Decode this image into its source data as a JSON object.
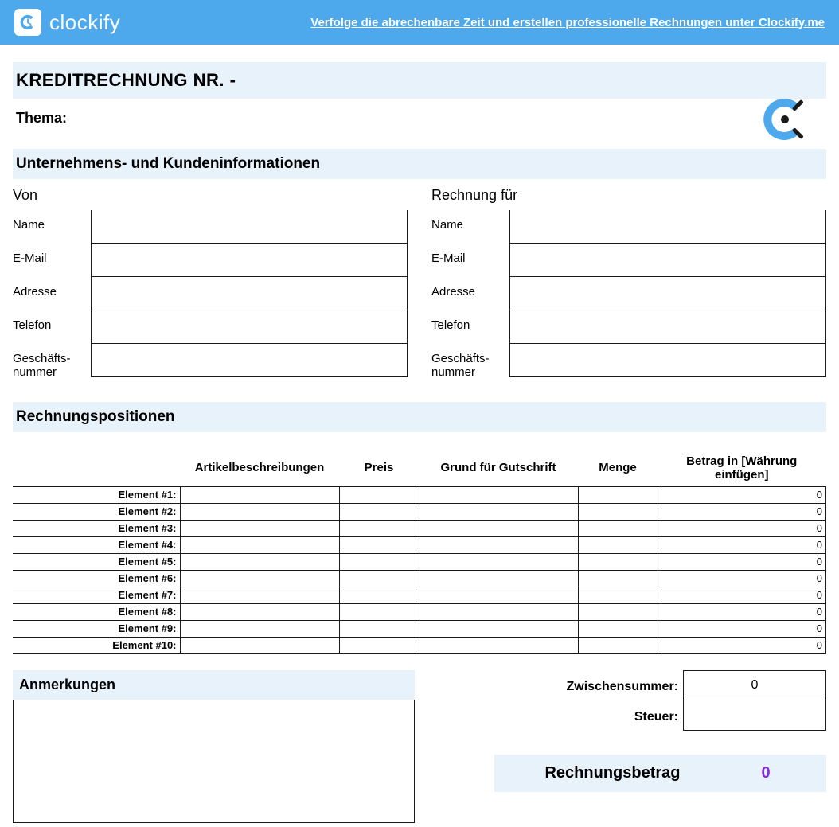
{
  "banner": {
    "brand": "clockify",
    "link_text": "Verfolge die abrechenbare Zeit und erstellen professionelle Rechnungen unter Clockify.me"
  },
  "title": "KREDITRECHNUNG NR. -",
  "subject_label": "Thema:",
  "section_info": "Unternehmens- und Kundeninformationen",
  "from_header": "Von",
  "to_header": "Rechnung für",
  "fields": {
    "name": "Name",
    "email": "E-Mail",
    "address": "Adresse",
    "phone": "Telefon",
    "biznum": "Geschäfts-nummer"
  },
  "section_lines": "Rechnungspositionen",
  "columns": {
    "desc": "Artikelbeschreibungen",
    "price": "Preis",
    "reason": "Grund für Gutschrift",
    "qty": "Menge",
    "amount": "Betrag in [Währung einfügen]"
  },
  "rows": [
    {
      "label": "Element #1:",
      "amount": "0"
    },
    {
      "label": "Element #2:",
      "amount": "0"
    },
    {
      "label": "Element #3:",
      "amount": "0"
    },
    {
      "label": "Element #4:",
      "amount": "0"
    },
    {
      "label": "Element #5:",
      "amount": "0"
    },
    {
      "label": "Element #6:",
      "amount": "0"
    },
    {
      "label": "Element #7:",
      "amount": "0"
    },
    {
      "label": "Element #8:",
      "amount": "0"
    },
    {
      "label": "Element #9:",
      "amount": "0"
    },
    {
      "label": "Element #10:",
      "amount": "0"
    }
  ],
  "notes_label": "Anmerkungen",
  "totals": {
    "subtotal_label": "Zwischensummer:",
    "subtotal_value": "0",
    "tax_label": "Steuer:",
    "tax_value": "",
    "final_label": "Rechnungsbetrag",
    "final_value": "0"
  }
}
